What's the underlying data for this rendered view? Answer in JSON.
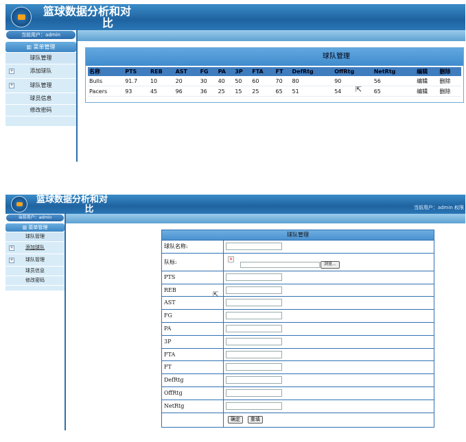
{
  "app": {
    "title_line1": "篮球数据分析和对",
    "title_line2": "比",
    "user_label": "当前用户：admin",
    "header_user_text": "当前用户：admin   权限"
  },
  "sidebar": {
    "menu_header": "菜单管理",
    "items": [
      {
        "label": "球队管理"
      },
      {
        "label": "添加球队"
      },
      {
        "label": "球队管理"
      },
      {
        "label": "球员信息"
      },
      {
        "label": "修改密码"
      }
    ]
  },
  "team_list": {
    "panel_title": "球队管理",
    "columns": [
      "名称",
      "PTS",
      "REB",
      "AST",
      "FG",
      "PA",
      "3P",
      "FTA",
      "FT",
      "DefRtg",
      "OffRtg",
      "NetRtg",
      "编辑",
      "删除"
    ],
    "rows": [
      [
        "Bulls",
        "91.7",
        "10",
        "20",
        "30",
        "40",
        "50",
        "60",
        "70",
        "80",
        "90",
        "56",
        "编辑",
        "删除"
      ],
      [
        "Pacers",
        "93",
        "45",
        "96",
        "36",
        "25",
        "15",
        "25",
        "65",
        "51",
        "54",
        "65",
        "编辑",
        "删除"
      ]
    ]
  },
  "add_form": {
    "panel_title": "球队管理",
    "team_name_label": "球队名称:",
    "logo_label": "队标:",
    "browse_label": "浏览...",
    "fields": [
      "PTS",
      "REB",
      "AST",
      "FG",
      "PA",
      "3P",
      "FTA",
      "FT",
      "DefRtg",
      "OffRtg",
      "NetRtg"
    ],
    "submit_label": "确定",
    "reset_label": "重填"
  }
}
